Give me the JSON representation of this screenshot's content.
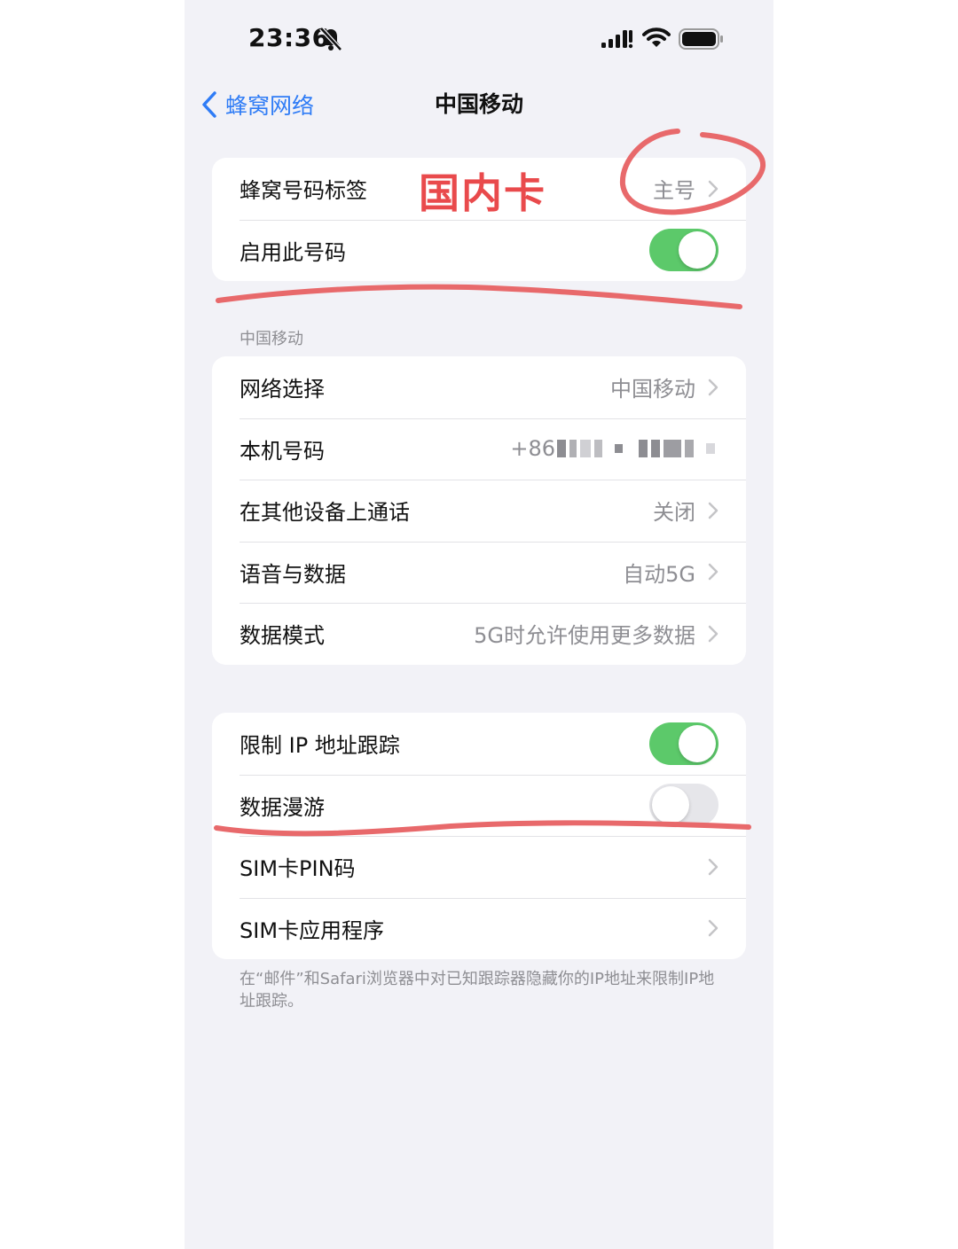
{
  "status_bar": {
    "time": "23:36"
  },
  "nav": {
    "back_label": "蜂窝网络",
    "title": "中国移动"
  },
  "group1": {
    "label_row": {
      "label": "蜂窝号码标签",
      "value": "主号"
    },
    "enable_row": {
      "label": "启用此号码",
      "toggle": "on"
    }
  },
  "section_header": "中国移动",
  "group2": [
    {
      "label": "网络选择",
      "value": "中国移动"
    },
    {
      "label": "本机号码",
      "value": "+86"
    },
    {
      "label": "在其他设备上通话",
      "value": "关闭"
    },
    {
      "label": "语音与数据",
      "value": "自动5G"
    },
    {
      "label": "数据模式",
      "value": "5G时允许使用更多数据"
    }
  ],
  "group3": {
    "limit_ip": {
      "label": "限制 IP 地址跟踪",
      "toggle": "on"
    },
    "roaming": {
      "label": "数据漫游",
      "toggle": "off"
    },
    "sim_pin": {
      "label": "SIM卡PIN码"
    },
    "sim_apps": {
      "label": "SIM卡应用程序"
    }
  },
  "footer_note": "在“邮件”和Safari浏览器中对已知跟踪器隐藏你的IP地址来限制IP地址跟踪。",
  "annotation": {
    "text": "国内卡",
    "color": "#e94a4c"
  },
  "colors": {
    "accent_blue": "#2f7cf6",
    "toggle_on": "#5cc96a",
    "background": "#f2f2f7"
  }
}
